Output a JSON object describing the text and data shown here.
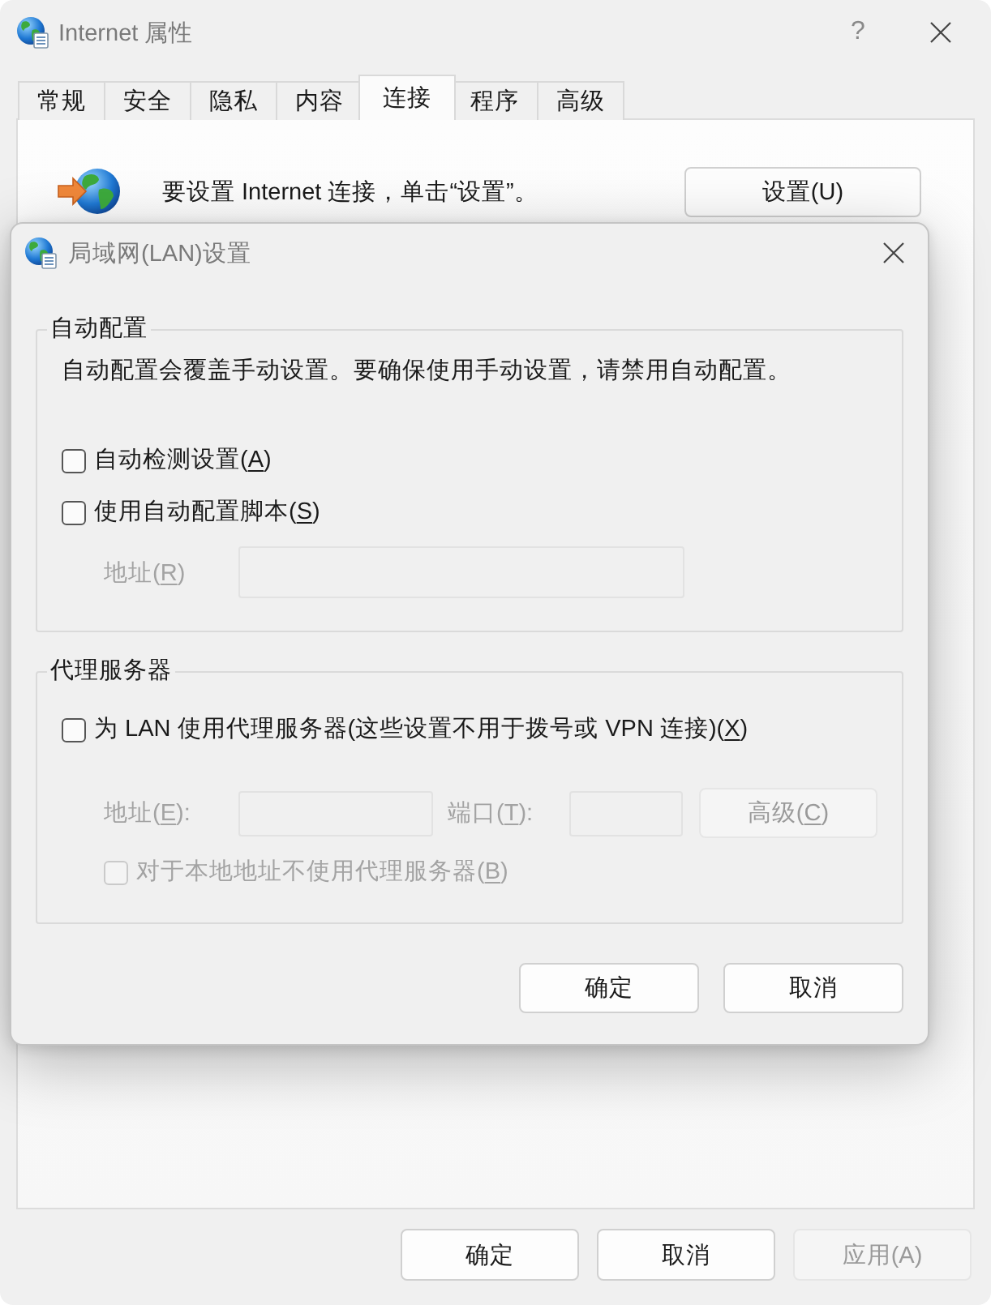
{
  "window": {
    "title": "Internet 属性",
    "help": "?"
  },
  "tabs": [
    {
      "label": "常规",
      "selected": false
    },
    {
      "label": "安全",
      "selected": false
    },
    {
      "label": "隐私",
      "selected": false
    },
    {
      "label": "内容",
      "selected": false
    },
    {
      "label": "连接",
      "selected": true
    },
    {
      "label": "程序",
      "selected": false
    },
    {
      "label": "高级",
      "selected": false
    }
  ],
  "connection": {
    "message": "要设置 Internet 连接，单击“设置”。",
    "setup_button": "设置(U)"
  },
  "lan_dialog": {
    "title": "局域网(LAN)设置",
    "groups": [
      {
        "legend": "自动配置",
        "description": "自动配置会覆盖手动设置。要确保使用手动设置，请禁用自动配置。",
        "rows": [
          {
            "kind": "checkbox",
            "label": "自动检测设置(",
            "access_key": "A",
            "label_end": ")",
            "checked": false,
            "disabled": false
          },
          {
            "kind": "checkbox",
            "label": "使用自动配置脚本(",
            "access_key": "S",
            "label_end": ")",
            "checked": false,
            "disabled": false,
            "children": [
              {
                "kind": "field",
                "label": "地址(",
                "access_key": "R",
                "label_end": ")",
                "disabled": true
              }
            ]
          }
        ]
      },
      {
        "legend": "代理服务器",
        "rows": [
          {
            "kind": "checkbox",
            "label": "为 LAN 使用代理服务器(这些设置不用于拨号或 VPN 连接)(",
            "access_key": "X",
            "label_end": ")",
            "checked": false,
            "disabled": false,
            "children": [
              {
                "kind": "proxy_fields",
                "address": {
                  "label": "地址(",
                  "access_key": "E",
                  "label_end": "):",
                  "disabled": true
                },
                "port": {
                  "label": "端口(",
                  "access_key": "T",
                  "label_end": "):",
                  "disabled": true
                },
                "advanced_button": {
                  "label": "高级(",
                  "access_key": "C",
                  "label_end": ")",
                  "disabled": true
                }
              },
              {
                "kind": "checkbox",
                "label": "对于本地地址不使用代理服务器(",
                "access_key": "B",
                "label_end": ")",
                "checked": false,
                "disabled": true
              }
            ]
          }
        ]
      }
    ],
    "buttons": [
      {
        "label": "确定",
        "disabled": false
      },
      {
        "label": "取消",
        "disabled": false
      }
    ]
  },
  "buttons": [
    {
      "label": "确定",
      "disabled": false
    },
    {
      "label": "取消",
      "disabled": false
    },
    {
      "label": "应用(A)",
      "disabled": true
    }
  ]
}
